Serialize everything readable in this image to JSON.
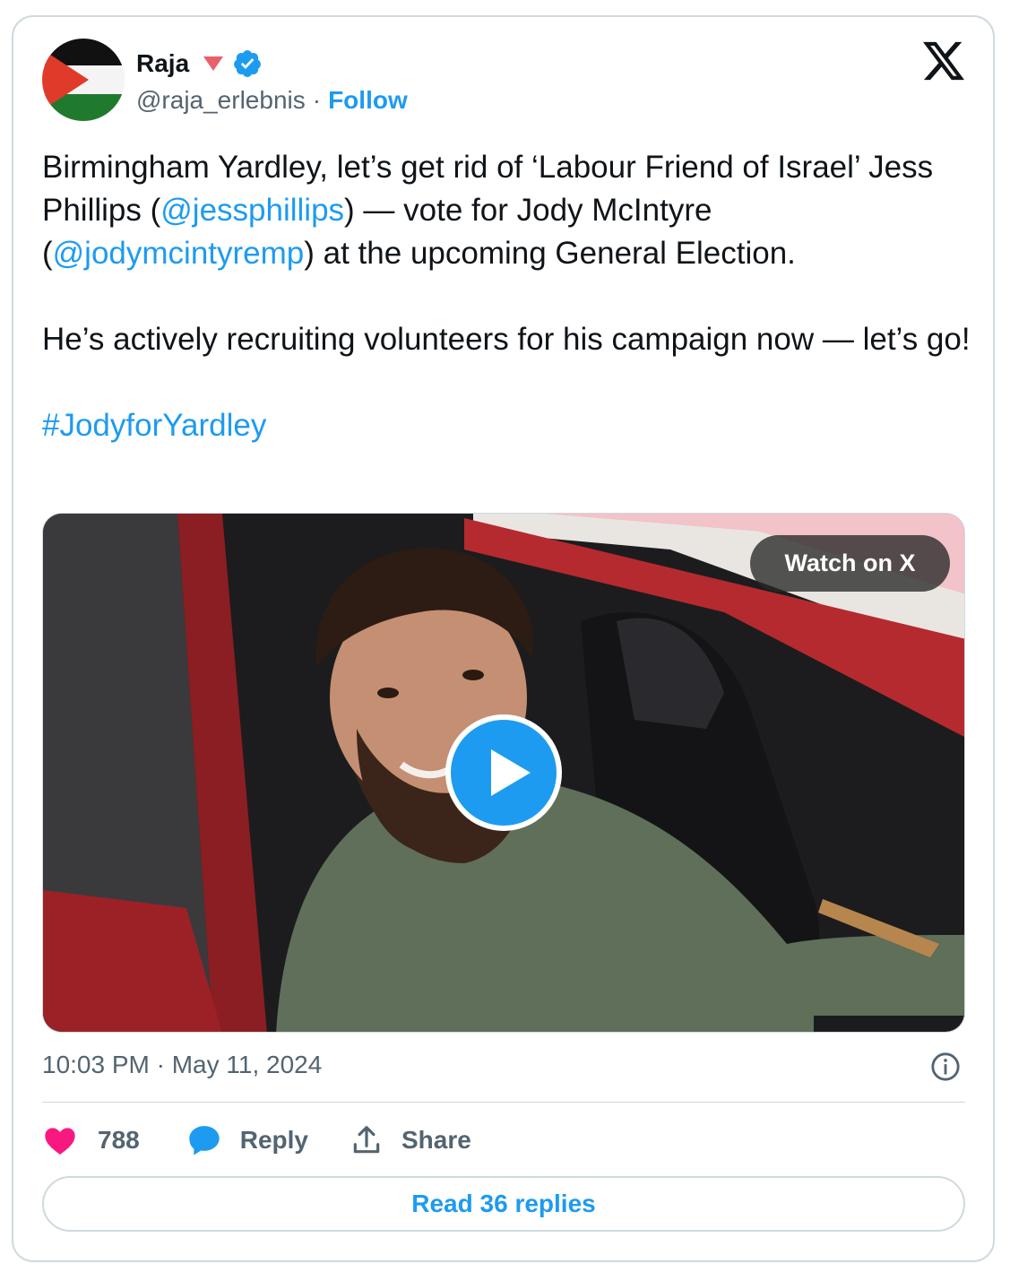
{
  "author": {
    "display_name": "Raja",
    "handle": "@raja_erlebnis",
    "separator": "·",
    "follow_label": "Follow"
  },
  "tweet": {
    "line1_pre": "Birmingham Yardley, let’s get rid of ‘Labour Friend of Israel’ Jess Phillips  (",
    "mention1": "@jessphillips",
    "line1_post": ") — vote for  Jody McIntyre (",
    "mention2": "@jodymcintyremp",
    "line1_end": ") at the upcoming General Election.",
    "para2": "He’s actively recruiting volunteers for his campaign now — let’s go!",
    "hashtag": "#JodyforYardley"
  },
  "media": {
    "watch_label": "Watch on X"
  },
  "meta": {
    "timestamp": "10:03 PM · May 11, 2024"
  },
  "actions": {
    "like_count": "788",
    "reply_label": "Reply",
    "share_label": "Share",
    "read_replies_label": "Read 36 replies"
  },
  "colors": {
    "accent": "#1d9bf0",
    "like": "#f91880",
    "muted": "#536471",
    "border": "#cfd9de"
  },
  "icons": [
    "palestine-flag-avatar",
    "red-triangle-icon",
    "verified-badge-icon",
    "x-logo-icon",
    "play-icon",
    "info-icon",
    "heart-icon",
    "reply-bubble-icon",
    "share-upload-icon"
  ]
}
